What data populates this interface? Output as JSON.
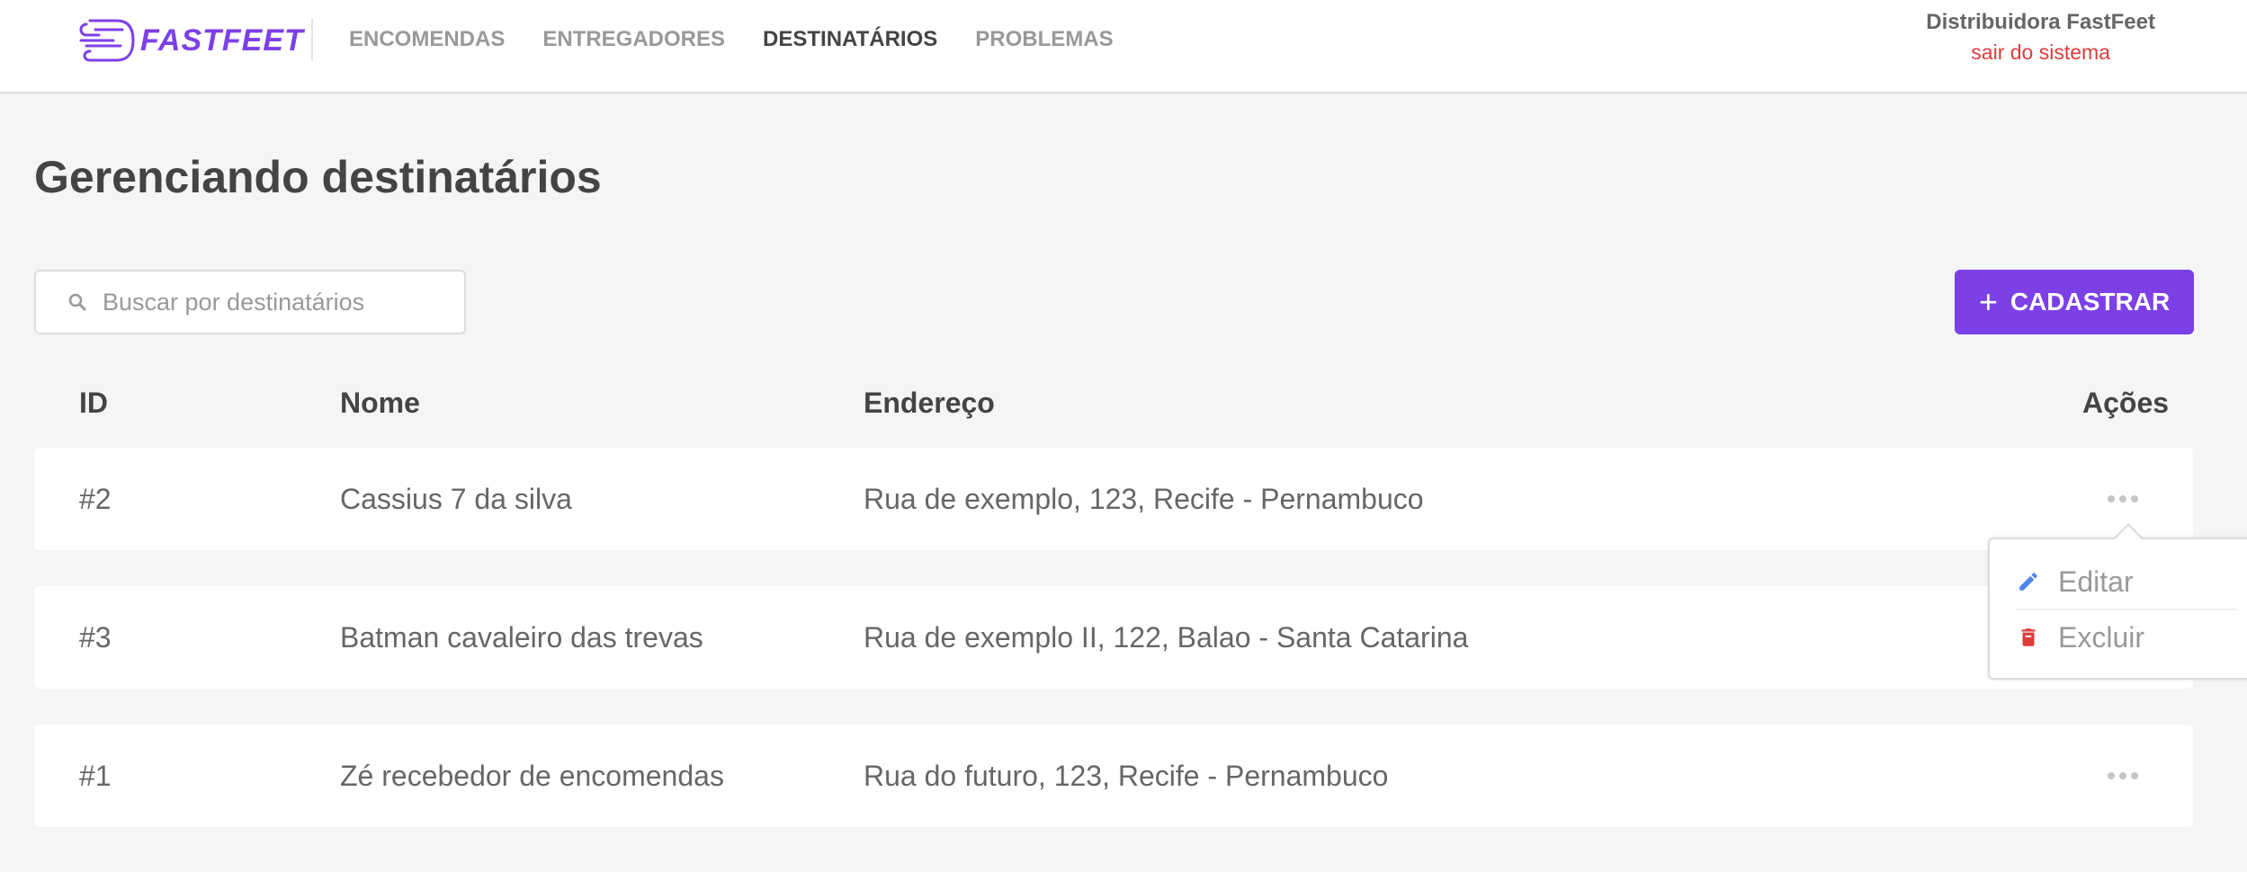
{
  "header": {
    "logo_text": "FASTFEET",
    "nav": [
      {
        "label": "ENCOMENDAS",
        "active": false
      },
      {
        "label": "ENTREGADORES",
        "active": false
      },
      {
        "label": "DESTINATÁRIOS",
        "active": true
      },
      {
        "label": "PROBLEMAS",
        "active": false
      }
    ],
    "user_name": "Distribuidora FastFeet",
    "logout_label": "sair do sistema"
  },
  "page": {
    "title": "Gerenciando destinatários"
  },
  "search": {
    "placeholder": "Buscar por destinatários",
    "value": "",
    "icon": "search-icon"
  },
  "add_button": {
    "label": "CADASTRAR",
    "icon": "plus-icon"
  },
  "table": {
    "columns": [
      "ID",
      "Nome",
      "Endereço",
      "Ações"
    ],
    "rows": [
      {
        "id": "#2",
        "name": "Cassius 7 da silva",
        "address": "Rua de exemplo, 123, Recife - Pernambuco"
      },
      {
        "id": "#3",
        "name": "Batman cavaleiro das trevas",
        "address": "Rua de exemplo II, 122, Balao - Santa Catarina"
      },
      {
        "id": "#1",
        "name": "Zé recebedor de encomendas",
        "address": "Rua do futuro, 123, Recife - Pernambuco"
      }
    ]
  },
  "actions_menu": {
    "open_for_row": 0,
    "items": [
      {
        "label": "Editar",
        "icon": "pencil-icon",
        "color": "#4d85ee"
      },
      {
        "label": "Excluir",
        "icon": "trash-icon",
        "color": "#de3b3b"
      }
    ]
  },
  "colors": {
    "brand": "#7d40e7",
    "background": "#f5f5f5",
    "danger": "#de3b3b",
    "edit": "#4d85ee"
  }
}
